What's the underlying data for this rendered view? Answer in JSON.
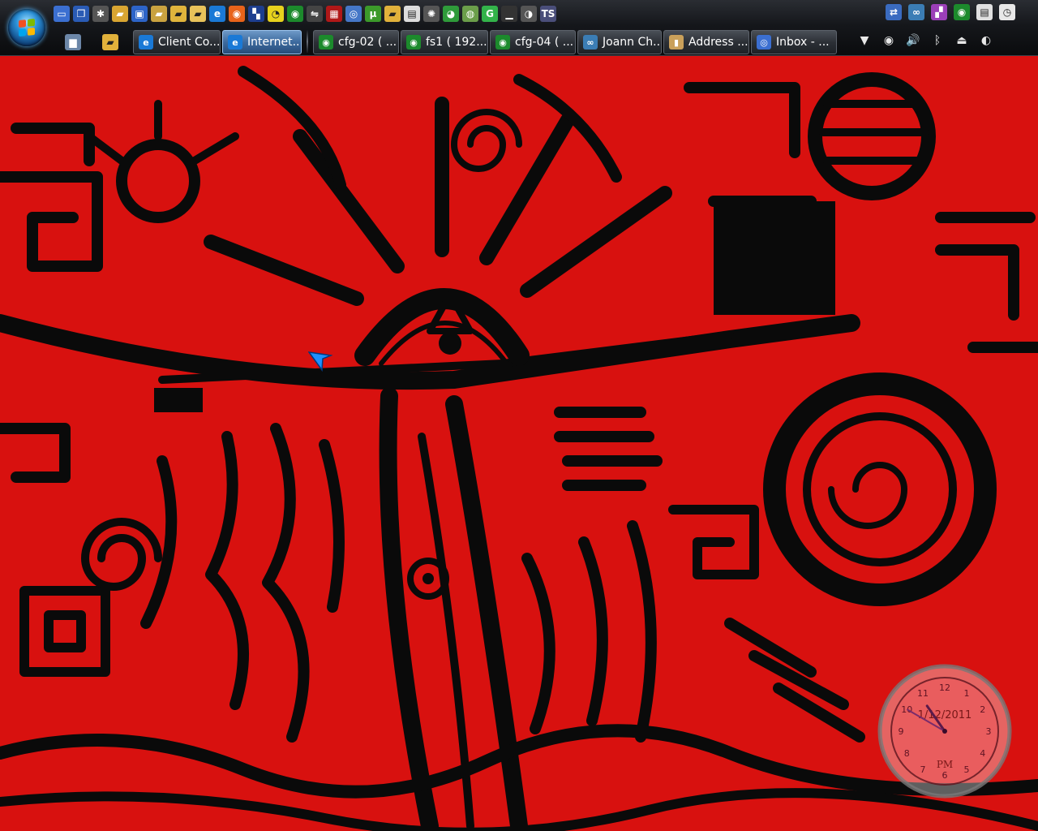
{
  "taskbar": {
    "quick_launch": [
      {
        "name": "show-desktop-icon",
        "glyph": "▭",
        "bg": "#3b6fd1"
      },
      {
        "name": "switch-windows-icon",
        "glyph": "❐",
        "bg": "#2a5bb5"
      },
      {
        "name": "settings-icon",
        "glyph": "✱",
        "bg": "#555"
      },
      {
        "name": "folder-icon",
        "glyph": "▰",
        "bg": "#d9a532"
      },
      {
        "name": "computer-icon",
        "glyph": "▣",
        "bg": "#2d64c8"
      },
      {
        "name": "folder-icon",
        "glyph": "▰",
        "bg": "#c9a240"
      },
      {
        "name": "folder-icon",
        "glyph": "▰",
        "bg": "#e0b43c"
      },
      {
        "name": "folder-icon",
        "glyph": "▰",
        "bg": "#e8c25a"
      },
      {
        "name": "internet-explorer-icon",
        "glyph": "e",
        "bg": "#1a79d6"
      },
      {
        "name": "firefox-icon",
        "glyph": "◉",
        "bg": "#e8631a"
      },
      {
        "name": "app-icon",
        "glyph": "▚",
        "bg": "#1d3e8f"
      },
      {
        "name": "pacman-icon",
        "glyph": "◔",
        "bg": "#e8d21d"
      },
      {
        "name": "eye-icon",
        "glyph": "◉",
        "bg": "#1c8a2c"
      },
      {
        "name": "tool-icon",
        "glyph": "⇋",
        "bg": "#444"
      },
      {
        "name": "calculator-icon",
        "glyph": "▦",
        "bg": "#b01818"
      },
      {
        "name": "globe-icon",
        "glyph": "◎",
        "bg": "#4577c7"
      },
      {
        "name": "utorrent-icon",
        "glyph": "µ",
        "bg": "#3c9a2a"
      },
      {
        "name": "folder-icon",
        "glyph": "▰",
        "bg": "#e1b13b"
      },
      {
        "name": "notepad-icon",
        "glyph": "▤",
        "bg": "#ddd"
      },
      {
        "name": "film-icon",
        "glyph": "✺",
        "bg": "#555"
      },
      {
        "name": "chrome-icon",
        "glyph": "◕",
        "bg": "#2f9b3a"
      },
      {
        "name": "network-icon",
        "glyph": "◍",
        "bg": "#6b9e4a"
      },
      {
        "name": "g-app-icon",
        "glyph": "G",
        "bg": "#33b34a"
      },
      {
        "name": "monitor-icon",
        "glyph": "▁",
        "bg": "#333"
      },
      {
        "name": "media-icon",
        "glyph": "◑",
        "bg": "#555"
      },
      {
        "name": "ts-icon",
        "glyph": "TS",
        "bg": "#4a4e7a"
      }
    ],
    "system_quick": [
      {
        "name": "network-connections-icon",
        "glyph": "⇄",
        "bg": "#3a6bc0"
      },
      {
        "name": "remote-icon",
        "glyph": "∞",
        "bg": "#3b7db5"
      },
      {
        "name": "puzzle-icon",
        "glyph": "▞",
        "bg": "#9b3fb8"
      },
      {
        "name": "eye-icon",
        "glyph": "◉",
        "bg": "#1c8a2c"
      },
      {
        "name": "document-icon",
        "glyph": "▤",
        "bg": "#e0e0e0"
      },
      {
        "name": "clock-icon",
        "glyph": "◷",
        "bg": "#e8e8e8"
      }
    ],
    "pinned": [
      {
        "name": "computer-icon",
        "glyph": "▆",
        "bg": "#6c87a8"
      },
      {
        "name": "folder-icon",
        "glyph": "▰",
        "bg": "#e1b13b"
      }
    ],
    "tasks": [
      {
        "label": "Client Co...",
        "icon": "internet-explorer-icon",
        "glyph": "e",
        "icon_bg": "#1a79d6",
        "active": false,
        "width": 108
      },
      {
        "label": "Internet...",
        "icon": "internet-explorer-icon",
        "glyph": "e",
        "icon_bg": "#1a79d6",
        "active": true,
        "width": 98
      },
      {
        "sep": true
      },
      {
        "label": "cfg-02 ( ...",
        "icon": "eye-icon",
        "glyph": "◉",
        "icon_bg": "#1c8a2c",
        "active": false,
        "width": 106
      },
      {
        "label": "fs1 ( 192....",
        "icon": "eye-icon",
        "glyph": "◉",
        "icon_bg": "#1c8a2c",
        "active": false,
        "width": 108
      },
      {
        "label": "cfg-04 ( ...",
        "icon": "eye-icon",
        "glyph": "◉",
        "icon_bg": "#1c8a2c",
        "active": false,
        "width": 106
      },
      {
        "label": "Joann Ch...",
        "icon": "chat-icon",
        "glyph": "∞",
        "icon_bg": "#3b7db5",
        "active": false,
        "width": 104
      },
      {
        "label": "Address ...",
        "icon": "address-book-icon",
        "glyph": "▮",
        "icon_bg": "#c9a05a",
        "active": false,
        "width": 106
      },
      {
        "label": "Inbox - ...",
        "icon": "outlook-icon",
        "glyph": "◎",
        "icon_bg": "#3b6fd1",
        "active": false,
        "width": 106
      }
    ],
    "tray": [
      {
        "name": "overflow-arrow-icon",
        "glyph": "▼"
      },
      {
        "name": "media-player-icon",
        "glyph": "◉"
      },
      {
        "name": "volume-icon",
        "glyph": "🔊"
      },
      {
        "name": "bluetooth-icon",
        "glyph": "ᛒ"
      },
      {
        "name": "usb-drive-icon",
        "glyph": "⏏"
      },
      {
        "name": "power-icon",
        "glyph": "◐"
      }
    ]
  },
  "clock_gadget": {
    "date": "1/12/2011",
    "ampm": "PM",
    "time": {
      "hour": 10,
      "minute": 50
    }
  },
  "colors": {
    "wallpaper_red": "#d8110f",
    "wallpaper_black": "#0a0a0a",
    "taskbar": "#15171b",
    "active_task": "#3d6a9e"
  }
}
